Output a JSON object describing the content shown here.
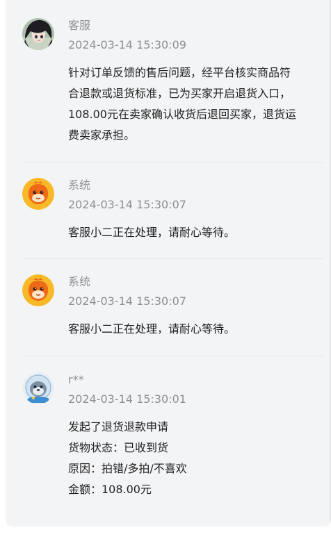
{
  "entries": [
    {
      "name": "客服",
      "time": "2024-03-14 15:30:09",
      "lines": [
        "针对订单反馈的售后问题，经平台核实商品符",
        "合退款或退货标准，已为买家开启退货入口，",
        "108.00元在卖家确认收货后退回买家，退货运",
        "费卖家承担。"
      ]
    },
    {
      "name": "系统",
      "time": "2024-03-14 15:30:07",
      "lines": [
        "客服小二正在处理，请耐心等待。"
      ]
    },
    {
      "name": "系统",
      "time": "2024-03-14 15:30:07",
      "lines": [
        "客服小二正在处理，请耐心等待。"
      ]
    },
    {
      "name": "r**",
      "time": "2024-03-14 15:30:01",
      "lines": [
        "发起了退货退款申请",
        "货物状态：已收到货",
        "原因：拍错/多拍/不喜欢",
        "金额：108.00元"
      ]
    }
  ]
}
